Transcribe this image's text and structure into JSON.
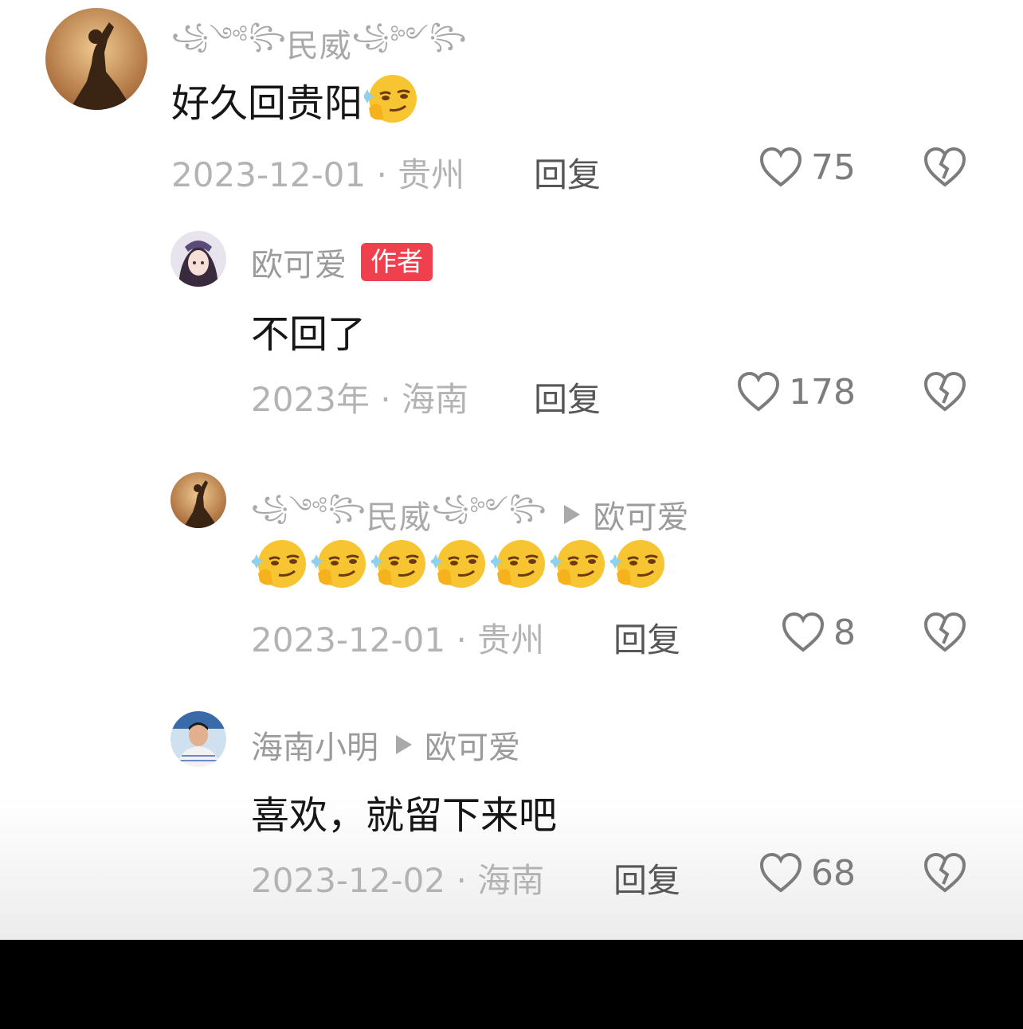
{
  "comments": [
    {
      "author": "民威",
      "author_deco_left": "꧁༺꧂",
      "author_deco_right": "꧁༻꧂",
      "is_author": false,
      "text": "好久回贵阳",
      "emoji": "smirk-thinking-emoji",
      "emoji_count": 1,
      "date": "2023-12-01",
      "location": "贵州",
      "reply_label": "回复",
      "likes": "75"
    },
    {
      "author": "欧可爱",
      "is_author": true,
      "author_badge": "作者",
      "text": "不回了",
      "date": "2023年",
      "location": "海南",
      "reply_label": "回复",
      "likes": "178"
    },
    {
      "author": "民威",
      "author_deco_left": "꧁༺꧂",
      "author_deco_right": "꧁༻꧂",
      "reply_to": "欧可爱",
      "emoji": "smirk-thinking-emoji",
      "emoji_count": 7,
      "date": "2023-12-01",
      "location": "贵州",
      "reply_label": "回复",
      "likes": "8"
    },
    {
      "author": "海南小明",
      "reply_to": "欧可爱",
      "text": "喜欢，就留下来吧",
      "date": "2023-12-02",
      "location": "海南",
      "reply_label": "回复",
      "likes": "68"
    }
  ],
  "meta_separator": "·",
  "icons": {
    "like": "heart-outline-icon",
    "dislike": "broken-heart-icon",
    "reply_arrow": "play-triangle-icon"
  },
  "colors": {
    "author_badge": "#f0404e",
    "meta_text": "#b3b3b3",
    "name_text": "#9b9b9b",
    "body_text": "#161616"
  }
}
